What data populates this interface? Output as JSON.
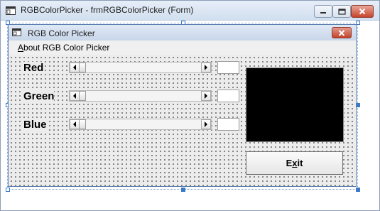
{
  "window": {
    "title": "RGBColorPicker - frmRGBColorPicker (Form)"
  },
  "form": {
    "title": "RGB Color Picker",
    "menu": {
      "about": {
        "mnemonic": "A",
        "rest": "bout RGB Color Picker"
      }
    }
  },
  "channels": [
    {
      "label": "Red",
      "value": ""
    },
    {
      "label": "Green",
      "value": ""
    },
    {
      "label": "Blue",
      "value": ""
    }
  ],
  "preview": {
    "color": "#000000"
  },
  "exit_button": {
    "before": "E",
    "mnemonic": "x",
    "after": "it"
  },
  "icons": {
    "window_icon": "form-icon",
    "minimize": "minimize-icon",
    "maximize": "maximize-icon",
    "close": "close-icon",
    "scroll_left": "scroll-left-arrow-icon",
    "scroll_right": "scroll-right-arrow-icon"
  }
}
